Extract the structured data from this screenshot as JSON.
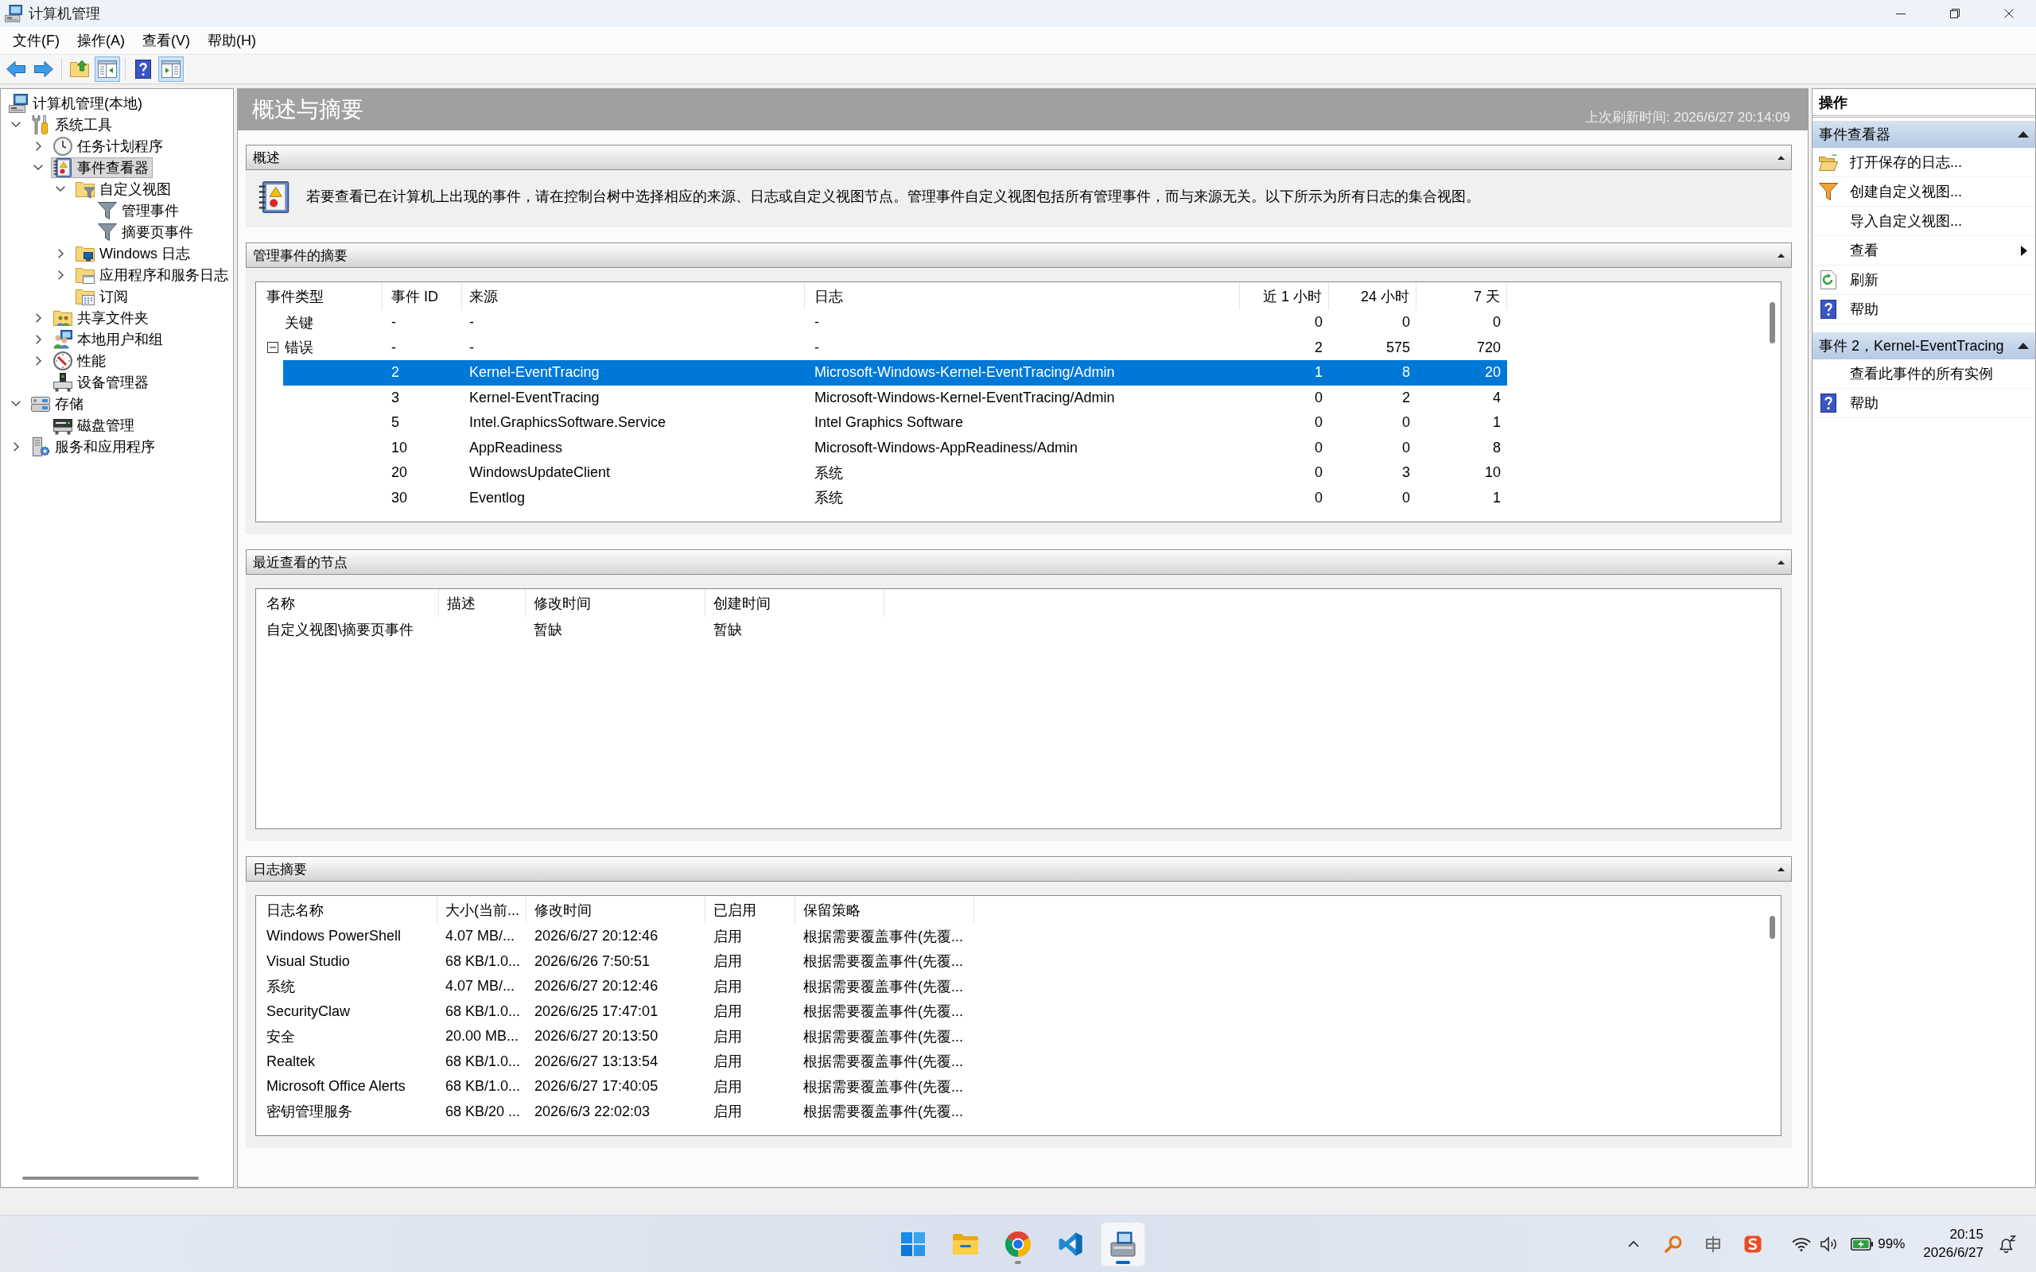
{
  "window": {
    "title": "计算机管理"
  },
  "menu": [
    "文件(F)",
    "操作(A)",
    "查看(V)",
    "帮助(H)"
  ],
  "toolbar": [
    [
      {
        "kind": "back",
        "on": false
      },
      {
        "kind": "forward",
        "on": false
      }
    ],
    [
      {
        "kind": "up",
        "on": false
      },
      {
        "kind": "console-tree",
        "on": true
      }
    ],
    [
      {
        "kind": "help",
        "on": false
      },
      {
        "kind": "action-pane",
        "on": true
      }
    ]
  ],
  "tree": [
    {
      "label": "计算机管理(本地)",
      "kind": "computer",
      "selected": false,
      "children": [
        {
          "label": "系统工具",
          "kind": "tools",
          "expanded": true,
          "selected": false,
          "children": [
            {
              "label": "任务计划程序",
              "kind": "clock",
              "expanded": false,
              "selected": false
            },
            {
              "label": "事件查看器",
              "kind": "event-viewer",
              "expanded": true,
              "selected": true,
              "children": [
                {
                  "label": "自定义视图",
                  "kind": "filter-folder",
                  "expanded": true,
                  "selected": false,
                  "children": [
                    {
                      "label": "管理事件",
                      "kind": "filter",
                      "selected": false
                    },
                    {
                      "label": "摘要页事件",
                      "kind": "filter",
                      "selected": false
                    }
                  ]
                },
                {
                  "label": "Windows 日志",
                  "kind": "monitor-folder",
                  "expanded": false,
                  "selected": false
                },
                {
                  "label": "应用程序和服务日志",
                  "kind": "window-folder",
                  "expanded": false,
                  "selected": false
                },
                {
                  "label": "订阅",
                  "kind": "calendar-folder",
                  "selected": false
                }
              ]
            },
            {
              "label": "共享文件夹",
              "kind": "shared-folder",
              "expanded": false,
              "selected": false
            },
            {
              "label": "本地用户和组",
              "kind": "users",
              "expanded": false,
              "selected": false
            },
            {
              "label": "性能",
              "kind": "gauge",
              "expanded": false,
              "selected": false
            },
            {
              "label": "设备管理器",
              "kind": "device",
              "selected": false
            }
          ]
        },
        {
          "label": "存储",
          "kind": "storage",
          "expanded": true,
          "selected": false,
          "children": [
            {
              "label": "磁盘管理",
              "kind": "disk",
              "selected": false
            }
          ]
        },
        {
          "label": "服务和应用程序",
          "kind": "services",
          "expanded": false,
          "selected": false
        }
      ]
    }
  ],
  "center": {
    "title": "概述与摘要",
    "refresh_time": "上次刷新时间: 2026/6/27 20:14:09",
    "sections": [
      {
        "kind": "overview",
        "title": "概述",
        "expanded": true,
        "text": "若要查看已在计算机上出现的事件，请在控制台树中选择相应的来源、日志或自定义视图节点。管理事件自定义视图包括所有管理事件，而与来源无关。以下所示为所有日志的集合视图。"
      },
      {
        "kind": "event-summary",
        "title": "管理事件的摘要",
        "expanded": true,
        "columns": {
          "type": "事件类型",
          "event_id": "事件 ID",
          "source": "来源",
          "log": "日志",
          "counts": [
            "近 1 小时",
            "24 小时",
            "7 天"
          ]
        },
        "rows": [
          {
            "type": "关键",
            "event_id": "-",
            "source": "-",
            "log": "-",
            "counts": [
              "0",
              "0",
              "0"
            ],
            "selected": false
          },
          {
            "type": "错误",
            "event_id": "-",
            "source": "-",
            "log": "-",
            "counts": [
              "2",
              "575",
              "720"
            ],
            "selected": false,
            "expanded": true,
            "children": [
              {
                "event_id": "2",
                "source": "Kernel-EventTracing",
                "log": "Microsoft-Windows-Kernel-EventTracing/Admin",
                "counts": [
                  "1",
                  "8",
                  "20"
                ],
                "selected": true
              },
              {
                "event_id": "3",
                "source": "Kernel-EventTracing",
                "log": "Microsoft-Windows-Kernel-EventTracing/Admin",
                "counts": [
                  "0",
                  "2",
                  "4"
                ],
                "selected": false
              },
              {
                "event_id": "5",
                "source": "Intel.GraphicsSoftware.Service",
                "log": "Intel Graphics Software",
                "counts": [
                  "0",
                  "0",
                  "1"
                ],
                "selected": false
              },
              {
                "event_id": "10",
                "source": "AppReadiness",
                "log": "Microsoft-Windows-AppReadiness/Admin",
                "counts": [
                  "0",
                  "0",
                  "8"
                ],
                "selected": false
              },
              {
                "event_id": "20",
                "source": "WindowsUpdateClient",
                "log": "系统",
                "counts": [
                  "0",
                  "3",
                  "10"
                ],
                "selected": false
              },
              {
                "event_id": "30",
                "source": "Eventlog",
                "log": "系统",
                "counts": [
                  "0",
                  "0",
                  "1"
                ],
                "selected": false
              }
            ]
          }
        ]
      },
      {
        "kind": "recent-nodes",
        "title": "最近查看的节点",
        "expanded": true,
        "columns": [
          "名称",
          "描述",
          "修改时间",
          "创建时间"
        ],
        "rows": [
          {
            "name": "自定义视图\\摘要页事件",
            "modified": "暂缺",
            "created": "暂缺"
          }
        ]
      },
      {
        "kind": "log-summary",
        "title": "日志摘要",
        "expanded": true,
        "columns": [
          "日志名称",
          "大小(当前...",
          "修改时间",
          "已启用",
          "保留策略"
        ],
        "rows": [
          {
            "name": "Windows PowerShell",
            "size": "4.07 MB/...",
            "modified": "2026/6/27 20:12:46",
            "enabled": "启用",
            "policy": "根据需要覆盖事件(先覆..."
          },
          {
            "name": "Visual Studio",
            "size": "68 KB/1.0...",
            "modified": "2026/6/26 7:50:51",
            "enabled": "启用",
            "policy": "根据需要覆盖事件(先覆..."
          },
          {
            "name": "系统",
            "size": "4.07 MB/...",
            "modified": "2026/6/27 20:12:46",
            "enabled": "启用",
            "policy": "根据需要覆盖事件(先覆..."
          },
          {
            "name": "SecurityClaw",
            "size": "68 KB/1.0...",
            "modified": "2026/6/25 17:47:01",
            "enabled": "启用",
            "policy": "根据需要覆盖事件(先覆..."
          },
          {
            "name": "安全",
            "size": "20.00 MB...",
            "modified": "2026/6/27 20:13:50",
            "enabled": "启用",
            "policy": "根据需要覆盖事件(先覆..."
          },
          {
            "name": "Realtek",
            "size": "68 KB/1.0...",
            "modified": "2026/6/27 13:13:54",
            "enabled": "启用",
            "policy": "根据需要覆盖事件(先覆..."
          },
          {
            "name": "Microsoft Office Alerts",
            "size": "68 KB/1.0...",
            "modified": "2026/6/27 17:40:05",
            "enabled": "启用",
            "policy": "根据需要覆盖事件(先覆..."
          },
          {
            "name": "密钥管理服务",
            "size": "68 KB/20 ...",
            "modified": "2026/6/3 22:02:03",
            "enabled": "启用",
            "policy": "根据需要覆盖事件(先覆..."
          }
        ]
      }
    ]
  },
  "actions": {
    "title": "操作",
    "groups": [
      {
        "title": "事件查看器",
        "expanded": true,
        "items": [
          {
            "label": "打开保存的日志...",
            "kind": "open"
          },
          {
            "label": "创建自定义视图...",
            "kind": "filter"
          },
          {
            "label": "导入自定义视图...",
            "kind": "plain"
          },
          {
            "label": "查看",
            "kind": "submenu"
          },
          {
            "label": "刷新",
            "kind": "refresh"
          },
          {
            "label": "帮助",
            "kind": "help"
          }
        ]
      },
      {
        "title": "事件 2，Kernel-EventTracing",
        "expanded": true,
        "items": [
          {
            "label": "查看此事件的所有实例",
            "kind": "plain"
          },
          {
            "label": "帮助",
            "kind": "help"
          }
        ]
      }
    ]
  },
  "taskbar": {
    "apps": [
      {
        "kind": "start",
        "running": false,
        "active": false
      },
      {
        "kind": "explorer",
        "running": false,
        "active": false
      },
      {
        "kind": "browser",
        "running": true,
        "active": false
      },
      {
        "kind": "editor",
        "running": false,
        "active": false
      },
      {
        "kind": "computer-management",
        "running": true,
        "active": true
      }
    ],
    "tray": [
      {
        "kind": "overflow"
      },
      {
        "kind": "magnifier"
      },
      {
        "kind": "boxed-cross"
      },
      {
        "kind": "swirl-logo"
      }
    ],
    "battery": "99%",
    "time": "20:15",
    "date": "2026/6/27"
  }
}
